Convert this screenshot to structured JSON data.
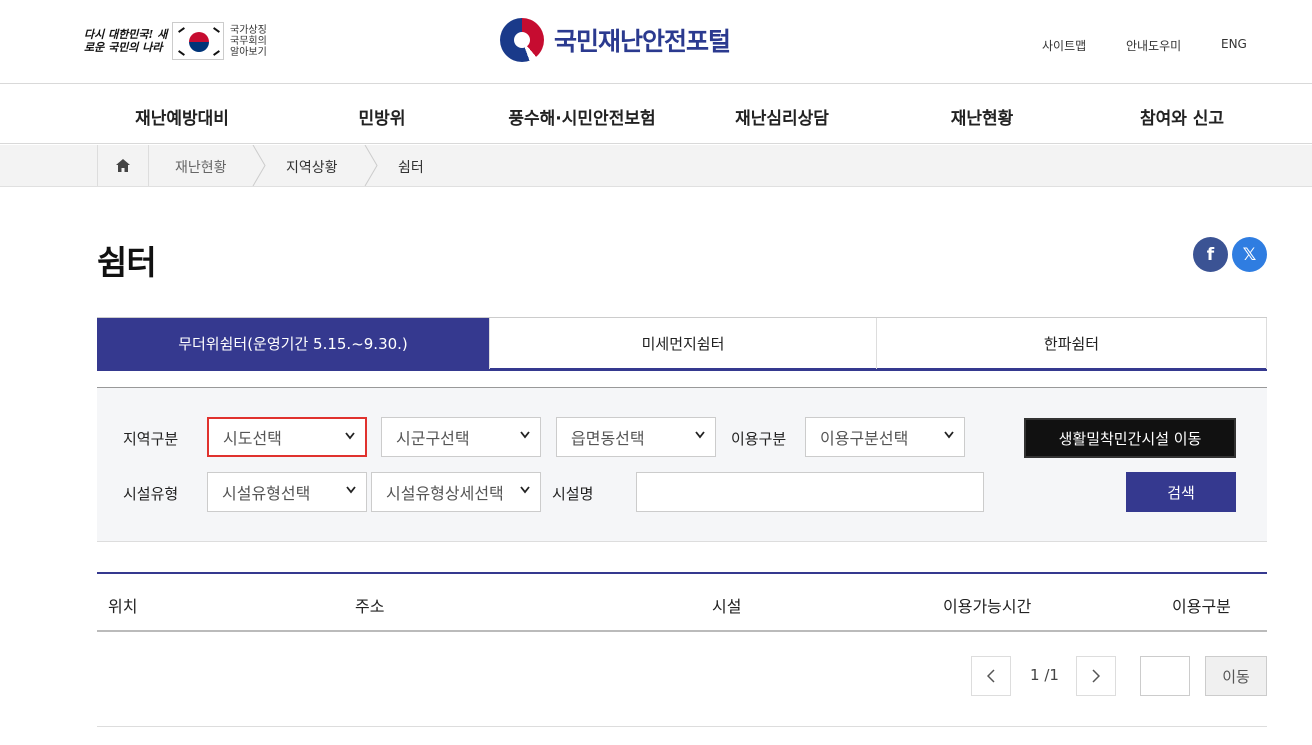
{
  "header": {
    "slogan": "다시 대한민국! 새로운 국민의 나라",
    "national_text": [
      "국가상징",
      "국무회의",
      "알아보기"
    ],
    "logo_text": "국민재난안전포털",
    "utility": [
      "사이트맵",
      "안내도우미",
      "ENG"
    ]
  },
  "gnb": [
    "재난예방대비",
    "민방위",
    "풍수해·시민안전보험",
    "재난심리상담",
    "재난현황",
    "참여와 신고"
  ],
  "breadcrumb": [
    "재난현황",
    "지역상황",
    "쉼터"
  ],
  "page": {
    "title": "쉼터",
    "sns": {
      "facebook": "f",
      "x": "𝕏"
    }
  },
  "tabs": [
    {
      "label": "무더위쉼터(운영기간 5.15.~9.30.)",
      "active": true
    },
    {
      "label": "미세먼지쉼터",
      "active": false
    },
    {
      "label": "한파쉼터",
      "active": false
    }
  ],
  "search": {
    "region_label": "지역구분",
    "sido": "시도선택",
    "sigungu": "시군구선택",
    "eupmyeondong": "읍면동선택",
    "usage_label": "이용구분",
    "usage": "이용구분선택",
    "private_button": "생활밀착민간시설 이동",
    "facility_type_label": "시설유형",
    "facility_type": "시설유형선택",
    "facility_detail": "시설유형상세선택",
    "facility_name_label": "시설명",
    "facility_name_value": "",
    "search_button": "검색"
  },
  "table": {
    "columns": [
      "위치",
      "주소",
      "시설",
      "이용가능시간",
      "이용구분"
    ]
  },
  "pagination": {
    "current": "1",
    "total": "1",
    "go_label": "이동"
  },
  "colors": {
    "accent": "#35398f",
    "focus": "#e0322e"
  }
}
